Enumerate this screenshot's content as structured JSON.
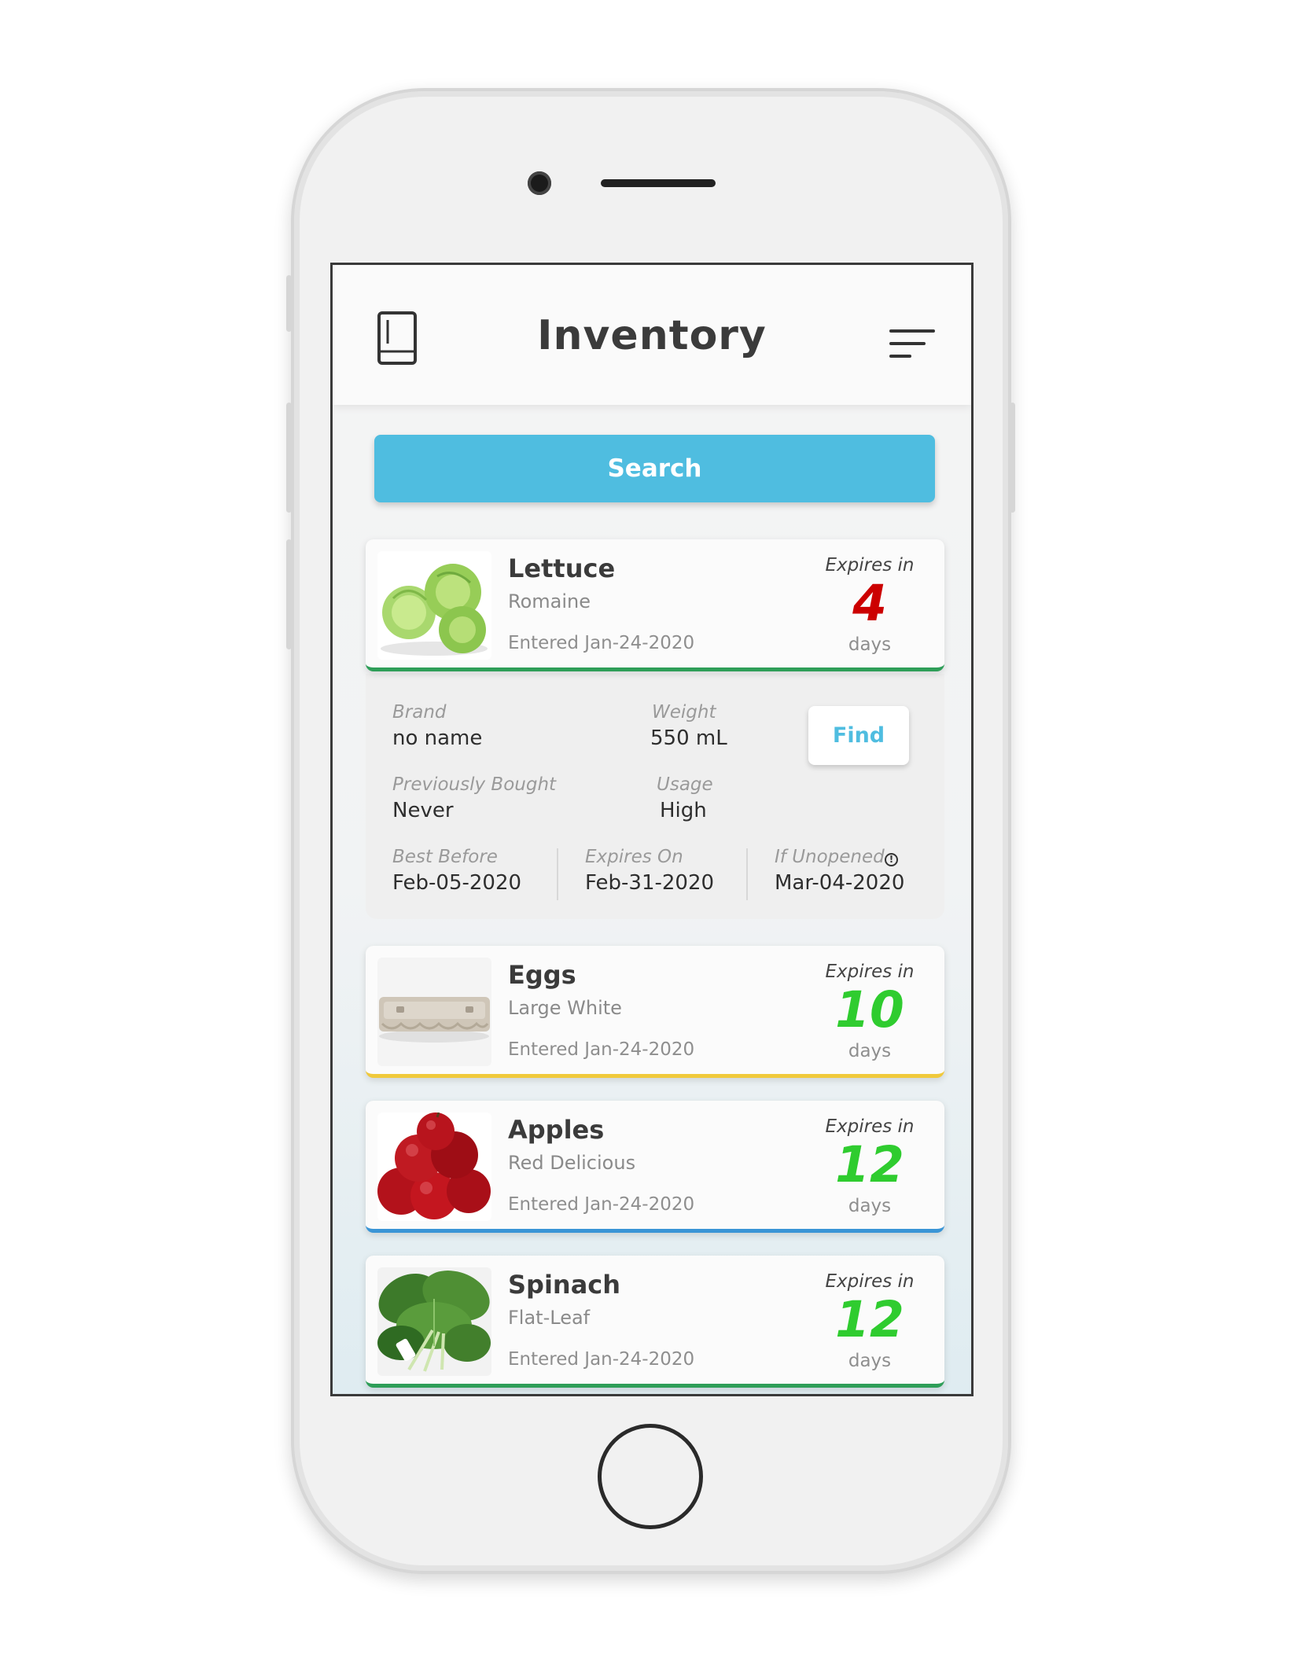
{
  "header": {
    "title": "Inventory",
    "left_icon": "fridge-icon",
    "right_icon": "filter-sort-icon"
  },
  "search": {
    "label": "Search"
  },
  "items": [
    {
      "name": "Lettuce",
      "variety": "Romaine",
      "entered": "Entered Jan-24-2020",
      "expires_label": "Expires in",
      "expires_value": "4",
      "expires_unit": "days",
      "value_color": "#cc0000",
      "accent_color": "#2e9e58",
      "image": "lettuce-image"
    },
    {
      "name": "Eggs",
      "variety": "Large White",
      "entered": "Entered Jan-24-2020",
      "expires_label": "Expires in",
      "expires_value": "10",
      "expires_unit": "days",
      "value_color": "#2fcc2f",
      "accent_color": "#f0c93b",
      "image": "egg-carton-image"
    },
    {
      "name": "Apples",
      "variety": "Red Delicious",
      "entered": "Entered Jan-24-2020",
      "expires_label": "Expires in",
      "expires_value": "12",
      "expires_unit": "days",
      "value_color": "#2fcc2f",
      "accent_color": "#3a95d6",
      "image": "apples-image"
    },
    {
      "name": "Spinach",
      "variety": "Flat-Leaf",
      "entered": "Entered Jan-24-2020",
      "expires_label": "Expires in",
      "expires_value": "12",
      "expires_unit": "days",
      "value_color": "#2fcc2f",
      "accent_color": "#2e9e58",
      "image": "spinach-image"
    }
  ],
  "details": {
    "brand_label": "Brand",
    "brand_value": "no name",
    "weight_label": "Weight",
    "weight_value": "550 mL",
    "find_label": "Find",
    "previously_label": "Previously Bought",
    "previously_value": "Never",
    "usage_label": "Usage",
    "usage_value": "High",
    "best_before_label": "Best Before",
    "best_before_value": "Feb-05-2020",
    "expires_on_label": "Expires On",
    "expires_on_value": "Feb-31-2020",
    "if_unopened_label": "If Unopened",
    "if_unopened_value": "Mar-04-2020",
    "info_icon": "info-icon"
  }
}
